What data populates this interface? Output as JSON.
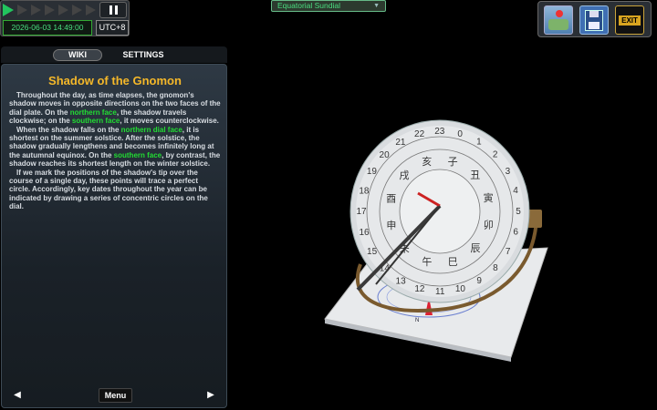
{
  "playback": {
    "datetime": "2026-06-03 14:49:00",
    "timezone": "UTC+8"
  },
  "model_select": {
    "value": "Equatorial Sundial"
  },
  "tabs": {
    "wiki": "WIKI",
    "settings": "SETTINGS"
  },
  "wiki": {
    "title": "Shadow of the Gnomon",
    "p1_a": "Throughout the day, as time elapses, the gnomon's shadow moves in opposite directions on the two faces of the dial plate. On the ",
    "p1_h1": "northern face",
    "p1_b": ", the shadow travels clockwise; on the ",
    "p1_h2": "southern face",
    "p1_c": ", it moves counterclockwise.",
    "p2_a": "When the shadow falls on the ",
    "p2_h1": "northern dial face",
    "p2_b": ", it is shortest on the summer solstice. After the solstice, the shadow gradually lengthens and becomes infinitely long at the autumnal equinox. On the ",
    "p2_h2": "southern face",
    "p2_c": ", by contrast, the shadow reaches its shortest length on the winter solstice.",
    "p3": "If we mark the positions of the shadow's tip over the course of a single day, these points will trace a perfect circle. Accordingly, key dates throughout the year can be indicated by drawing a series of concentric circles on the dial."
  },
  "nav": {
    "menu": "Menu",
    "prev_icon": "◀",
    "next_icon": "▶"
  },
  "dial": {
    "hours_left": [
      "23",
      "22",
      "21",
      "20",
      "19",
      "18",
      "17",
      "16",
      "15",
      "14",
      "13",
      "12"
    ],
    "hours_right": [
      "0",
      "1",
      "2",
      "3",
      "4",
      "5",
      "6",
      "7",
      "8",
      "9",
      "10",
      "11"
    ],
    "branches": [
      "子",
      "丑",
      "寅",
      "卯",
      "辰",
      "巳",
      "午",
      "未",
      "申",
      "酉",
      "戌",
      "亥"
    ],
    "compass_n": "N"
  },
  "colors": {
    "accent_green": "#22dd33",
    "title_gold": "#f5b829"
  }
}
